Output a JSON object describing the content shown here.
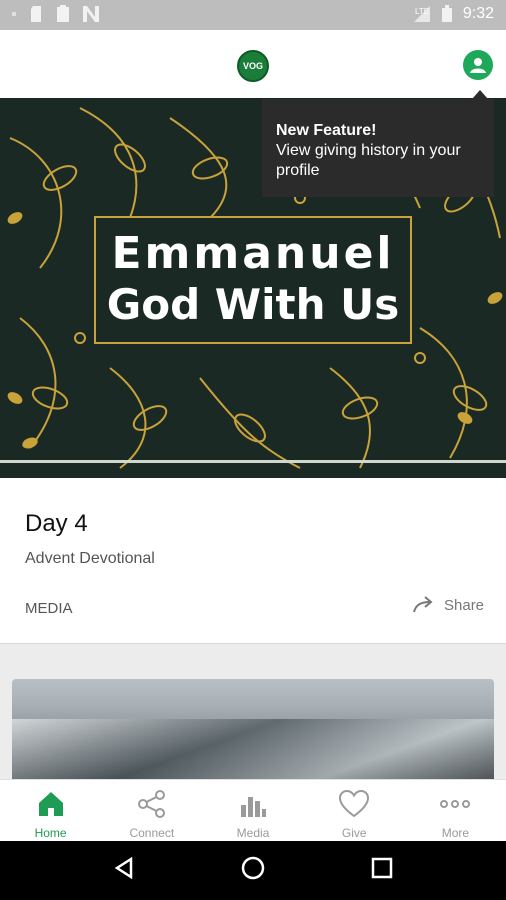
{
  "status_bar": {
    "time": "9:32"
  },
  "header": {
    "logo_text": "VOG"
  },
  "tooltip": {
    "title": "New Feature!",
    "body": "View giving history in your profile"
  },
  "banner": {
    "line1": "Emmanuel",
    "line2": "God With Us"
  },
  "card": {
    "title": "Day 4",
    "subtitle": "Advent Devotional",
    "type": "MEDIA",
    "share_label": "Share"
  },
  "bottom_nav": {
    "items": [
      {
        "label": "Home",
        "icon": "home-icon",
        "active": true
      },
      {
        "label": "Connect",
        "icon": "share-network-icon",
        "active": false
      },
      {
        "label": "Media",
        "icon": "media-bars-icon",
        "active": false
      },
      {
        "label": "Give",
        "icon": "heart-icon",
        "active": false
      },
      {
        "label": "More",
        "icon": "more-dots-icon",
        "active": false
      }
    ]
  },
  "colors": {
    "accent": "#1e9c54",
    "banner_bg": "#1a2924",
    "banner_gold": "#c9a33a",
    "tooltip_bg": "#2b2b2b"
  }
}
